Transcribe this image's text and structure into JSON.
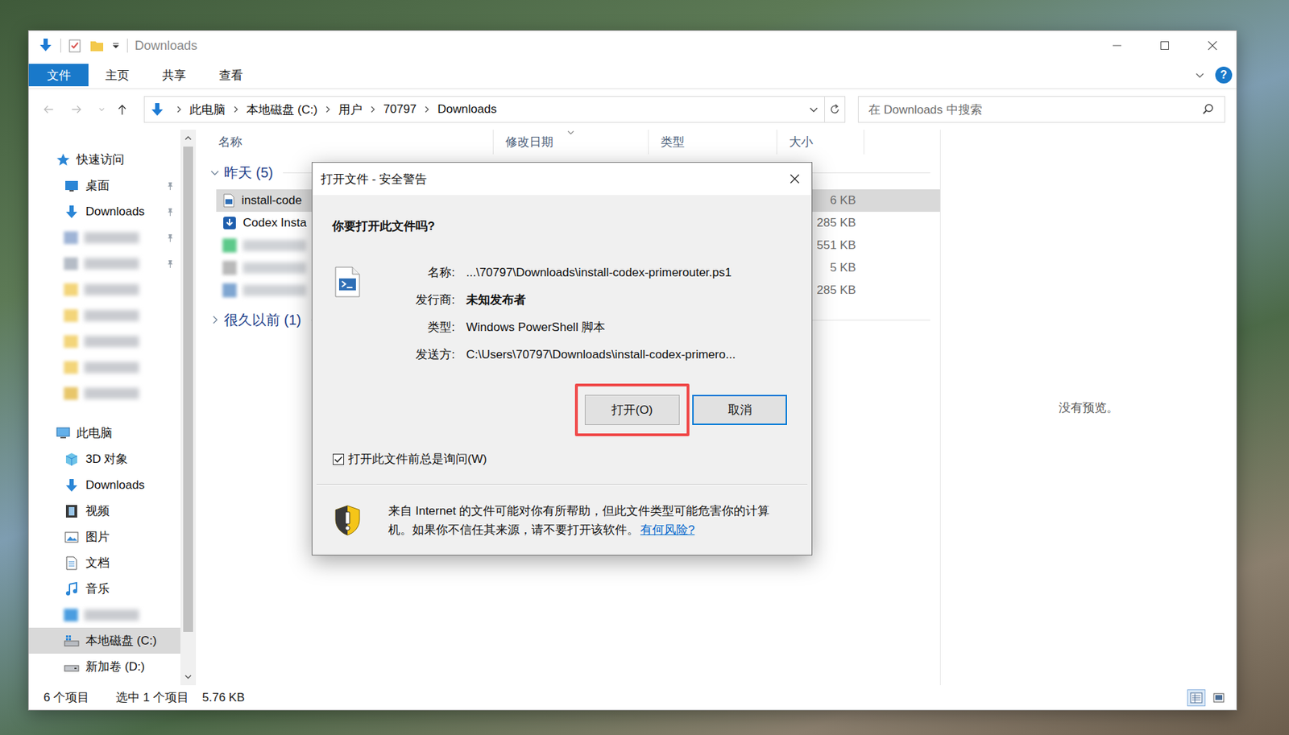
{
  "window": {
    "title": "Downloads"
  },
  "ribbon": {
    "tabs": [
      {
        "label": "文件",
        "selected": true
      },
      {
        "label": "主页",
        "selected": false
      },
      {
        "label": "共享",
        "selected": false
      },
      {
        "label": "查看",
        "selected": false
      }
    ],
    "help": "?"
  },
  "nav": {
    "back_disabled": true,
    "forward_disabled": true,
    "up_disabled": false
  },
  "address": {
    "crumbs": [
      "此电脑",
      "本地磁盘 (C:)",
      "用户",
      "70797",
      "Downloads"
    ]
  },
  "search": {
    "placeholder": "在 Downloads 中搜索"
  },
  "sidebar": {
    "scroll_level": 0.93,
    "items": [
      {
        "label": "快速访问",
        "kind": "quick",
        "pinned": false,
        "selected": false
      },
      {
        "label": "桌面",
        "kind": "desktop",
        "pinned": true,
        "selected": false
      },
      {
        "label": "Downloads",
        "kind": "downloads",
        "pinned": true,
        "selected": false
      },
      {
        "kind": "blurred",
        "color": "#9fb4d6",
        "pinned": true,
        "selected": false
      },
      {
        "kind": "blurred",
        "color": "#b5bcc6",
        "pinned": true,
        "selected": false
      },
      {
        "kind": "blurred",
        "color": "#f3d57a",
        "pinned": false,
        "selected": false
      },
      {
        "kind": "blurred",
        "color": "#f3d57a",
        "pinned": false,
        "selected": false
      },
      {
        "kind": "blurred",
        "color": "#f3d57a",
        "pinned": false,
        "selected": false
      },
      {
        "kind": "blurred",
        "color": "#f3d57a",
        "pinned": false,
        "selected": false
      },
      {
        "kind": "blurred",
        "color": "#e8c66a",
        "pinned": false,
        "selected": false
      },
      {
        "label": "此电脑",
        "kind": "computer",
        "pinned": false,
        "selected": false
      },
      {
        "label": "3D 对象",
        "kind": "objects3d",
        "pinned": false,
        "selected": false
      },
      {
        "label": "Downloads",
        "kind": "downloads",
        "pinned": false,
        "selected": false
      },
      {
        "label": "视频",
        "kind": "video",
        "pinned": false,
        "selected": false
      },
      {
        "label": "图片",
        "kind": "pictures",
        "pinned": false,
        "selected": false
      },
      {
        "label": "文档",
        "kind": "documents",
        "pinned": false,
        "selected": false
      },
      {
        "label": "音乐",
        "kind": "music",
        "pinned": false,
        "selected": false
      },
      {
        "kind": "blurred",
        "color": "#4a9de0",
        "pinned": false,
        "selected": false
      },
      {
        "label": "本地磁盘 (C:)",
        "kind": "drive-system",
        "pinned": false,
        "selected": true
      },
      {
        "label": "新加卷 (D:)",
        "kind": "drive",
        "pinned": false,
        "selected": false
      }
    ]
  },
  "table": {
    "columns": [
      {
        "label": "名称",
        "sorted": false
      },
      {
        "label": "修改日期",
        "sorted": true
      },
      {
        "label": "类型",
        "sorted": false
      },
      {
        "label": "大小",
        "sorted": false
      }
    ],
    "groups": [
      {
        "label": "昨天 (5)",
        "expanded": true,
        "rows": [
          {
            "name": "install-code",
            "kind": "script",
            "size": "6 KB",
            "selected": true
          },
          {
            "name": "Codex Insta",
            "kind": "installer",
            "size": "285 KB",
            "selected": false
          },
          {
            "kind": "blurred",
            "color": "#5cc98a",
            "size": "551 KB",
            "selected": false
          },
          {
            "kind": "blurred",
            "color": "#b9b9b9",
            "size": "5 KB",
            "selected": false
          },
          {
            "kind": "blurred",
            "color": "#7fa6d1",
            "size": "285 KB",
            "selected": false
          }
        ]
      },
      {
        "label": "很久以前 (1)",
        "expanded": false,
        "rows": []
      }
    ]
  },
  "preview": {
    "text": "没有预览。"
  },
  "status_bar": {
    "count": "6 个项目",
    "selection": "选中 1 个项目",
    "size": "5.76 KB",
    "views": [
      {
        "kind": "details",
        "selected": true
      },
      {
        "kind": "large-icons",
        "selected": false
      }
    ]
  },
  "dialog": {
    "title": "打开文件 - 安全警告",
    "question": "你要打开此文件吗?",
    "fields": [
      {
        "label": "名称:",
        "value": "...\\70797\\Downloads\\install-codex-primerouter.ps1",
        "bold": false
      },
      {
        "label": "发行商:",
        "value": "未知发布者",
        "bold": true
      },
      {
        "label": "类型:",
        "value": "Windows PowerShell 脚本",
        "bold": false
      },
      {
        "label": "发送方:",
        "value": "C:\\Users\\70797\\Downloads\\install-codex-primero...",
        "bold": false
      }
    ],
    "buttons": [
      {
        "label": "打开(O)",
        "default": false,
        "highlighted": true
      },
      {
        "label": "取消",
        "default": true,
        "highlighted": false
      }
    ],
    "checkbox": {
      "label": "打开此文件前总是询问(W)",
      "checked": true
    },
    "warning": {
      "text": "来自 Internet 的文件可能对你有所帮助，但此文件类型可能危害你的计算机。如果你不信任其来源，请不要打开该软件。",
      "link": "有何风险?"
    }
  }
}
